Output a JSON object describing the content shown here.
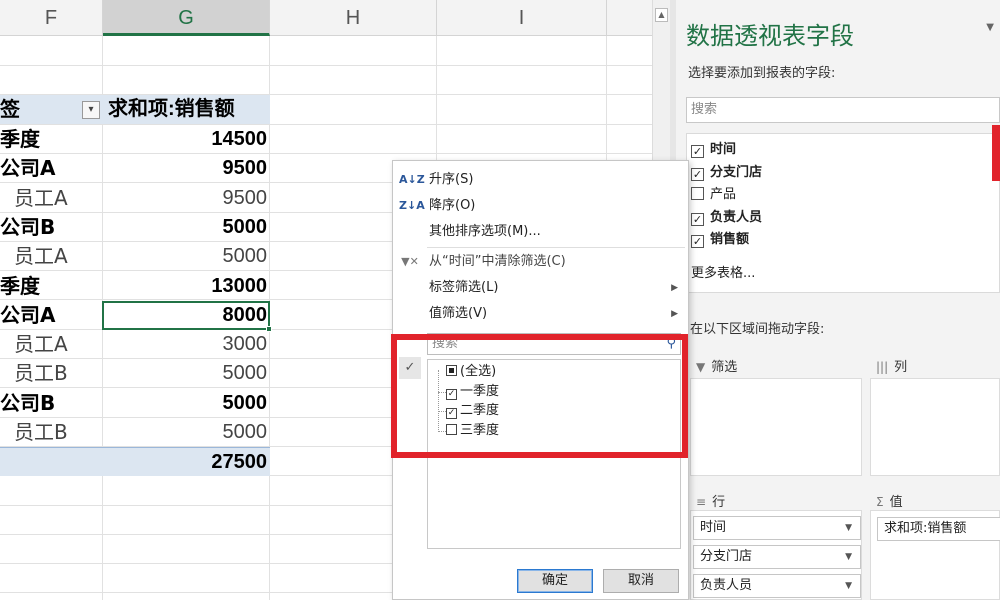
{
  "sheet": {
    "columns": [
      "F",
      "G",
      "H",
      "I"
    ],
    "selected_column": "G",
    "header": {
      "label": "签",
      "value": "求和项:销售额"
    },
    "rows": [
      {
        "label": "季度",
        "value": "14500",
        "bold": true
      },
      {
        "label": "公司A",
        "value": "9500",
        "bold": true
      },
      {
        "label": "员工A",
        "value": "9500",
        "bold": false
      },
      {
        "label": "公司B",
        "value": "5000",
        "bold": true
      },
      {
        "label": "员工A",
        "value": "5000",
        "bold": false
      },
      {
        "label": "季度",
        "value": "13000",
        "bold": true
      },
      {
        "label": "公司A",
        "value": "8000",
        "bold": true
      },
      {
        "label": "员工A",
        "value": "3000",
        "bold": false
      },
      {
        "label": "员工B",
        "value": "5000",
        "bold": false
      },
      {
        "label": "公司B",
        "value": "5000",
        "bold": true
      },
      {
        "label": "员工B",
        "value": "5000",
        "bold": false
      }
    ],
    "total": {
      "label": "",
      "value": "27500"
    }
  },
  "menu": {
    "sort_asc": "升序(S)",
    "sort_desc": "降序(O)",
    "more_sort": "其他排序选项(M)...",
    "clear_filter": "从“时间”中清除筛选(C)",
    "label_filter": "标签筛选(L)",
    "value_filter": "值筛选(V)",
    "search_placeholder": "搜索",
    "items": [
      {
        "label": "(全选)",
        "state": "partial"
      },
      {
        "label": "一季度",
        "state": "checked"
      },
      {
        "label": "二季度",
        "state": "checked"
      },
      {
        "label": "三季度",
        "state": "unchecked"
      }
    ],
    "ok": "确定",
    "cancel": "取消"
  },
  "pane": {
    "title": "数据透视表字段",
    "subtitle": "选择要添加到报表的字段:",
    "search_placeholder": "搜索",
    "fields": [
      {
        "label": "时间",
        "checked": true
      },
      {
        "label": "分支门店",
        "checked": true
      },
      {
        "label": "产品",
        "checked": false
      },
      {
        "label": "负责人员",
        "checked": true
      },
      {
        "label": "销售额",
        "checked": true
      }
    ],
    "more_tables": "更多表格...",
    "drag_hint": "在以下区域间拖动字段:",
    "areas": {
      "filter": "筛选",
      "columns": "列",
      "rows": "行",
      "values": "值"
    },
    "row_fields": [
      "时间",
      "分支门店",
      "负责人员"
    ],
    "value_fields": [
      "求和项:销售额"
    ]
  },
  "colors": {
    "accent": "#217346",
    "highlight": "#e1232b",
    "pivot_header": "#dce6f1"
  }
}
